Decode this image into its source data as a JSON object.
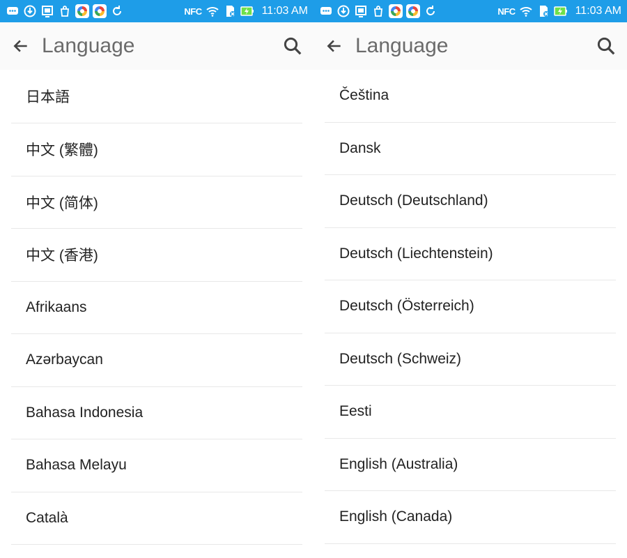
{
  "status_bar": {
    "time": "11:03 AM",
    "nfc_label": "NFC",
    "icons": [
      "chat-icon",
      "download-icon",
      "screenshot-icon",
      "bag-icon",
      "app-icon",
      "app-icon",
      "sync-icon",
      "nfc-icon",
      "wifi-icon",
      "sd-card-icon",
      "battery-charging-icon"
    ],
    "background_color": "#1e9de8"
  },
  "left": {
    "toolbar": {
      "title": "Language",
      "back_icon": "arrow-back-icon",
      "search_icon": "search-icon"
    },
    "languages": [
      "日本語",
      "中文 (繁體)",
      "中文 (简体)",
      "中文 (香港)",
      "Afrikaans",
      "Azərbaycan",
      "Bahasa Indonesia",
      "Bahasa Melayu",
      "Català"
    ]
  },
  "right": {
    "toolbar": {
      "title": "Language",
      "back_icon": "arrow-back-icon",
      "search_icon": "search-icon"
    },
    "languages": [
      "Čeština",
      "Dansk",
      "Deutsch (Deutschland)",
      "Deutsch (Liechtenstein)",
      "Deutsch (Österreich)",
      "Deutsch (Schweiz)",
      "Eesti",
      "English (Australia)",
      "English (Canada)"
    ]
  }
}
